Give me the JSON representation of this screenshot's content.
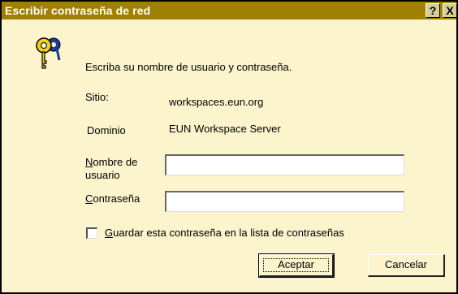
{
  "window": {
    "title": "Escribir contraseña de red",
    "help_label": "?",
    "close_label": "X"
  },
  "dialog": {
    "prompt": "Escriba su nombre de usuario y contraseña.",
    "site_label": "Sitio:",
    "site_value": "workspaces.eun.org",
    "domain_label": "Dominio",
    "domain_value": "EUN Workspace Server",
    "username_label_first": "N",
    "username_label_rest": "ombre de",
    "username_label_line2": "usuario",
    "username_value": "",
    "password_label_first": "C",
    "password_label_rest": "ontraseña",
    "password_value": "",
    "save_label_first": "G",
    "save_label_rest": "uardar esta contraseña en la lista de contraseñas",
    "save_checked": false,
    "ok_label": "Aceptar",
    "cancel_label": "Cancelar"
  },
  "colors": {
    "titlebar": "#a08000",
    "dialog_bg": "#fcf4cc"
  },
  "icons": [
    "keys-icon"
  ]
}
